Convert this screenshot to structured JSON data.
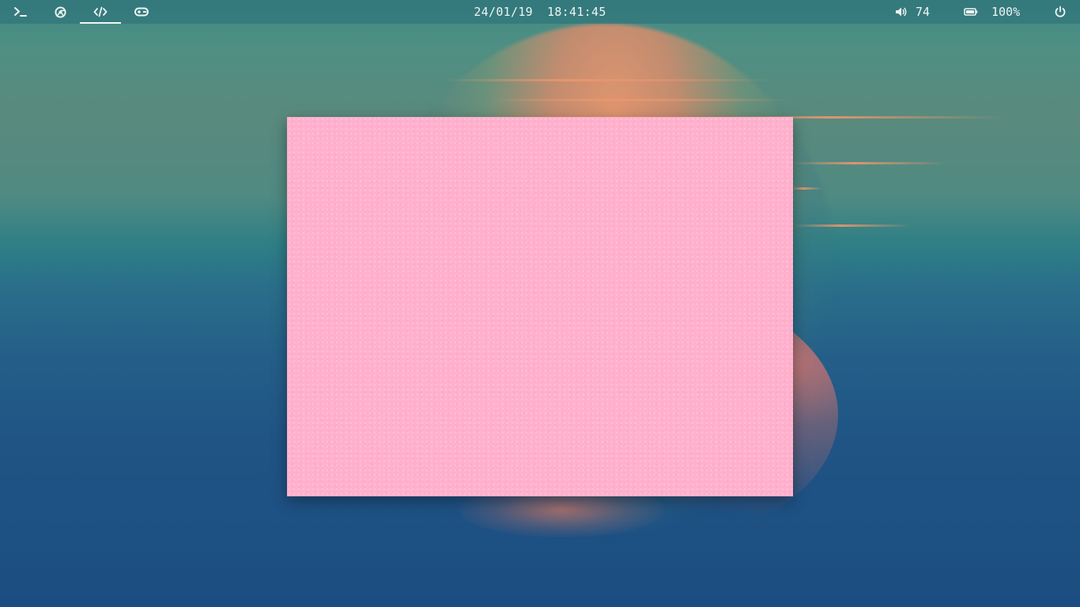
{
  "topbar": {
    "workspaces": [
      {
        "name": "terminal",
        "icon": "terminal-icon",
        "active": false
      },
      {
        "name": "browser",
        "icon": "chrome-icon",
        "active": false
      },
      {
        "name": "code",
        "icon": "code-icon",
        "active": true
      },
      {
        "name": "games",
        "icon": "gamepad-icon",
        "active": false
      }
    ],
    "clock": {
      "date": "24/01/19",
      "time": "18:41:45"
    },
    "volume": {
      "icon": "volume-icon",
      "value": "74"
    },
    "battery": {
      "icon": "battery-icon",
      "value": "100%"
    },
    "power": {
      "icon": "power-icon"
    }
  },
  "window": {
    "background_color": "#ffb0cd"
  },
  "colors": {
    "bar_text": "#eef4f2",
    "bar_background": "#2a6e76",
    "accent_underline": "#f2f6f5"
  }
}
